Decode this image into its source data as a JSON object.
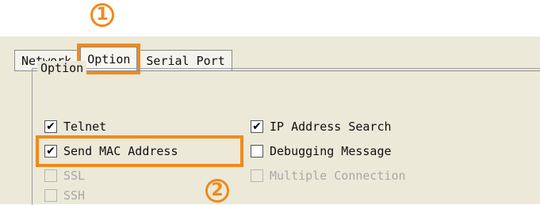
{
  "callouts": {
    "one": "1",
    "two": "2"
  },
  "tabs": [
    {
      "label": "Network",
      "active": false
    },
    {
      "label": "Option",
      "active": true
    },
    {
      "label": "Serial Port",
      "active": false
    }
  ],
  "group": {
    "title": "Option",
    "left_column": [
      {
        "label": "Telnet",
        "checked": true,
        "enabled": true
      },
      {
        "label": "Send MAC Address",
        "checked": true,
        "enabled": true
      },
      {
        "label": "SSL",
        "checked": false,
        "enabled": false
      },
      {
        "label": "SSH",
        "checked": false,
        "enabled": false
      }
    ],
    "right_column": [
      {
        "label": "IP Address Search",
        "checked": true,
        "enabled": true
      },
      {
        "label": "Debugging Message",
        "checked": false,
        "enabled": true
      },
      {
        "label": "Multiple Connection",
        "checked": false,
        "enabled": false
      }
    ]
  },
  "checkmark": "✔",
  "colors": {
    "highlight": "#f08a1c",
    "panel": "#ece9d8"
  }
}
